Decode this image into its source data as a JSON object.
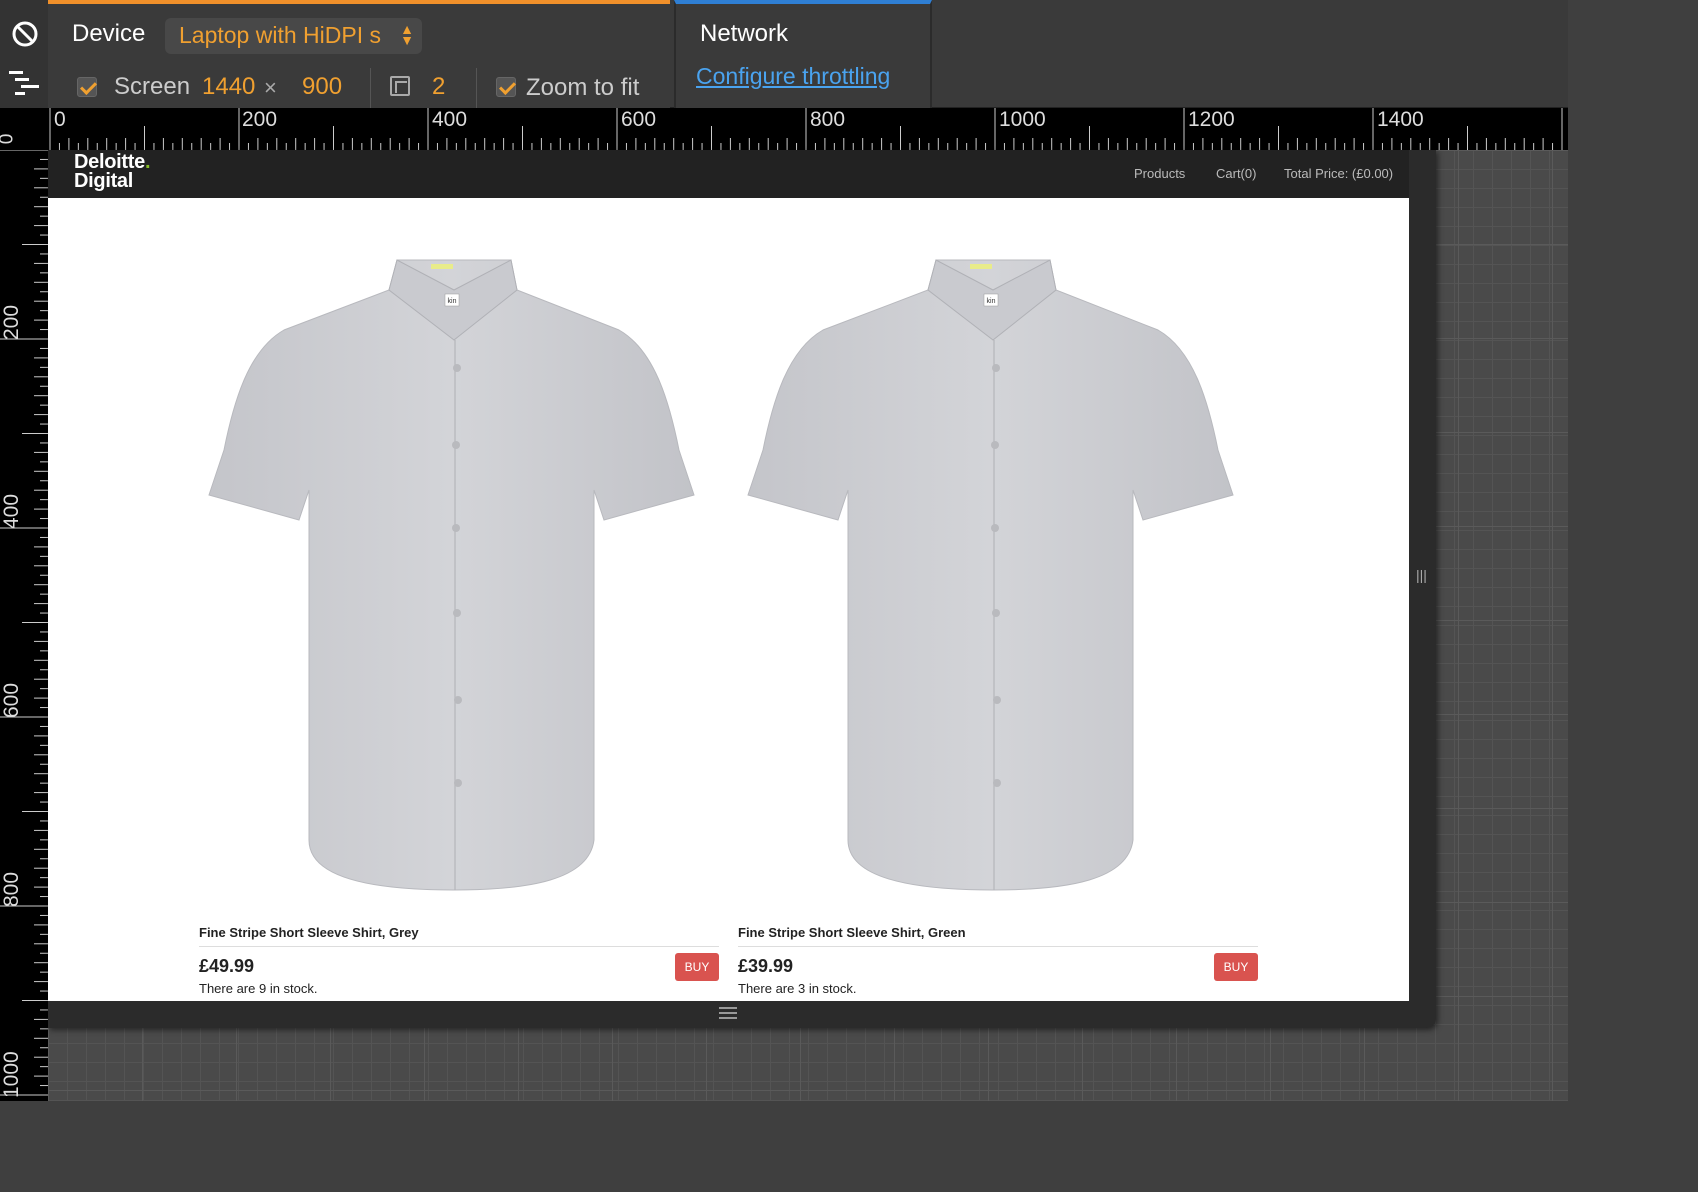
{
  "toolbar": {
    "device_label": "Device",
    "device_select": "Laptop with HiDPI s",
    "screen_label": "Screen",
    "screen_width": "1440",
    "screen_times": "×",
    "screen_height": "900",
    "dpr": "2",
    "zoom_label": "Zoom to fit",
    "network_label": "Network",
    "throttle_link": "Configure throttling"
  },
  "ruler": {
    "origin": "0",
    "top_labels": [
      "0",
      "200",
      "400",
      "600",
      "800",
      "1000",
      "1200",
      "1400"
    ],
    "left_labels": [
      "200",
      "400",
      "600",
      "800",
      "1000"
    ]
  },
  "site": {
    "logo_line1": "Deloitte",
    "logo_dot": ".",
    "logo_line2": "Digital",
    "nav": {
      "products": "Products",
      "cart": "Cart(0)",
      "total": "Total Price: (£0.00)"
    },
    "products": [
      {
        "name": "Fine Stripe Short Sleeve Shirt, Grey",
        "price": "£49.99",
        "stock": "There are 9 in stock.",
        "buy": "BUY",
        "label_tag": "kin"
      },
      {
        "name": "Fine Stripe Short Sleeve Shirt, Green",
        "price": "£39.99",
        "stock": "There are 3 in stock.",
        "buy": "BUY",
        "label_tag": "kin"
      }
    ]
  },
  "colors": {
    "accent_orange": "#f0a030",
    "accent_blue": "#4aa3ef",
    "buy_red": "#d9534f",
    "logo_green": "#86bc25"
  }
}
